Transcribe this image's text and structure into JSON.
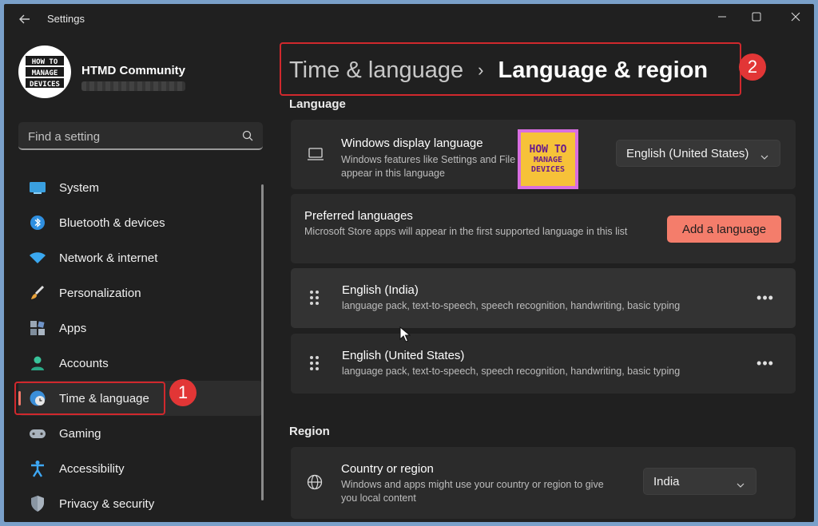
{
  "window": {
    "title": "Settings"
  },
  "profile": {
    "name": "HTMD Community",
    "logo_text": "HOW TO MANAGE DEVICES"
  },
  "search": {
    "placeholder": "Find a setting"
  },
  "sidebar": {
    "items": [
      {
        "label": "System",
        "icon": "system-icon"
      },
      {
        "label": "Bluetooth & devices",
        "icon": "bluetooth-icon"
      },
      {
        "label": "Network & internet",
        "icon": "wifi-icon"
      },
      {
        "label": "Personalization",
        "icon": "brush-icon"
      },
      {
        "label": "Apps",
        "icon": "apps-icon"
      },
      {
        "label": "Accounts",
        "icon": "account-icon"
      },
      {
        "label": "Time & language",
        "icon": "time-language-icon",
        "active": true
      },
      {
        "label": "Gaming",
        "icon": "gamepad-icon"
      },
      {
        "label": "Accessibility",
        "icon": "accessibility-icon"
      },
      {
        "label": "Privacy & security",
        "icon": "shield-icon"
      }
    ]
  },
  "breadcrumb": {
    "parent": "Time & language",
    "current": "Language & region"
  },
  "annotations": {
    "badge1": "1",
    "badge2": "2"
  },
  "language_section": {
    "title": "Language",
    "display_language": {
      "title": "Windows display language",
      "desc": "Windows features like Settings and File Explorer will appear in this language",
      "value": "English (United States)"
    },
    "preferred": {
      "title": "Preferred languages",
      "desc": "Microsoft Store apps will appear in the first supported language in this list",
      "button": "Add a language"
    },
    "languages": [
      {
        "name": "English (India)",
        "features": "language pack, text-to-speech, speech recognition, handwriting, basic typing"
      },
      {
        "name": "English (United States)",
        "features": "language pack, text-to-speech, speech recognition, handwriting, basic typing"
      }
    ]
  },
  "region_section": {
    "title": "Region",
    "country": {
      "title": "Country or region",
      "desc": "Windows and apps might use your country or region to give you local content",
      "value": "India"
    }
  },
  "watermark": {
    "line1": "HOW TO",
    "line2": "MANAGE DEVICES"
  },
  "colors": {
    "accent": "#f47d6b",
    "highlight": "#d0282d",
    "window_bg": "#202020",
    "card_bg": "#2b2b2b"
  }
}
